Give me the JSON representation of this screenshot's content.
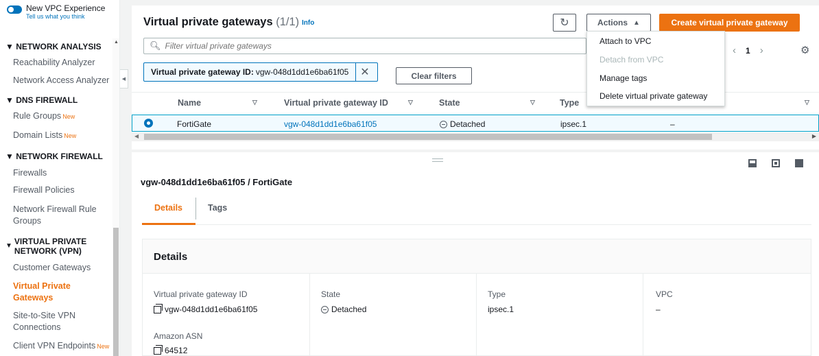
{
  "sidebar": {
    "toggle_label": "New VPC Experience",
    "toggle_sub": "Tell us what you think",
    "sections": [
      {
        "title": "NETWORK ANALYSIS",
        "items": [
          {
            "label": "Reachability Analyzer"
          },
          {
            "label": "Network Access Analyzer"
          }
        ]
      },
      {
        "title": "DNS FIREWALL",
        "items": [
          {
            "label": "Rule Groups",
            "badge": "New"
          },
          {
            "label": "Domain Lists",
            "badge": "New"
          }
        ]
      },
      {
        "title": "NETWORK FIREWALL",
        "items": [
          {
            "label": "Firewalls"
          },
          {
            "label": "Firewall Policies"
          },
          {
            "label_line1": "Network Firewall Rule",
            "label_line2": "Groups"
          }
        ]
      },
      {
        "title_line1": "VIRTUAL PRIVATE",
        "title_line2": "NETWORK (VPN)",
        "items": [
          {
            "label": "Customer Gateways"
          },
          {
            "label_line1": "Virtual Private",
            "label_line2": "Gateways",
            "active": true
          },
          {
            "label_line1": "Site-to-Site VPN",
            "label_line2": "Connections"
          },
          {
            "label": "Client VPN Endpoints",
            "badge": "New"
          }
        ]
      }
    ]
  },
  "header": {
    "title": "Virtual private gateways",
    "count": "(1/1)",
    "info": "Info",
    "actions_label": "Actions",
    "create_label": "Create virtual private gateway"
  },
  "search": {
    "placeholder": "Filter virtual private gateways"
  },
  "filter": {
    "label": "Virtual private gateway ID:",
    "value": "vgw-048d1dd1e6ba61f05"
  },
  "clear_filters": "Clear filters",
  "pagination": {
    "page": "1"
  },
  "actions_menu": [
    {
      "label": "Attach to VPC",
      "disabled": false
    },
    {
      "label": "Detach from VPC",
      "disabled": true
    },
    {
      "label": "Manage tags",
      "disabled": false
    },
    {
      "label": "Delete virtual private gateway",
      "disabled": false
    }
  ],
  "table": {
    "columns": [
      "Name",
      "Virtual private gateway ID",
      "State",
      "Type"
    ],
    "rows": [
      {
        "name": "FortiGate",
        "id": "vgw-048d1dd1e6ba61f05",
        "state": "Detached",
        "type": "ipsec.1",
        "extra": "–",
        "selected": true
      }
    ]
  },
  "split": {
    "title": "vgw-048d1dd1e6ba61f05 / FortiGate",
    "tabs": [
      "Details",
      "Tags"
    ],
    "details_heading": "Details",
    "fields": {
      "vgw_id_label": "Virtual private gateway ID",
      "vgw_id": "vgw-048d1dd1e6ba61f05",
      "asn_label": "Amazon ASN",
      "asn": "64512",
      "state_label": "State",
      "state": "Detached",
      "type_label": "Type",
      "type": "ipsec.1",
      "vpc_label": "VPC",
      "vpc": "–"
    }
  },
  "colors": {
    "accent": "#ec7211",
    "link": "#0073bb"
  }
}
